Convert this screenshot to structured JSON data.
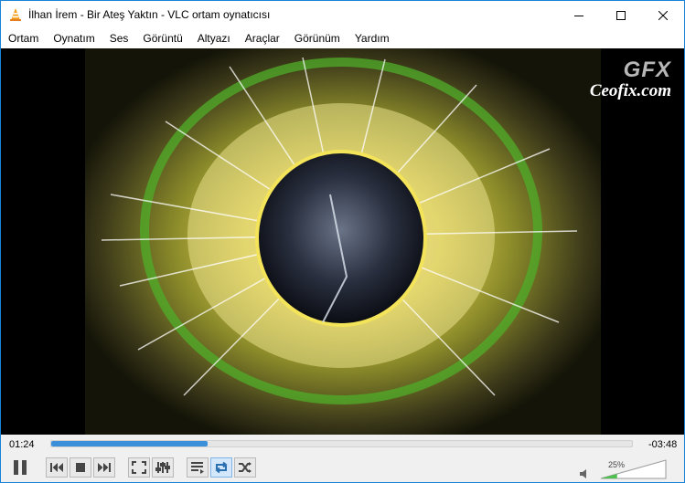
{
  "window": {
    "title": "İlhan İrem - Bir Ateş Yaktın - VLC ortam oynatıcısı",
    "accent_color": "#1883d7"
  },
  "menu": {
    "items": [
      "Ortam",
      "Oynatım",
      "Ses",
      "Görüntü",
      "Altyazı",
      "Araçlar",
      "Görünüm",
      "Yardım"
    ]
  },
  "watermark": {
    "mark": "GFX",
    "text": "Ceofix.com"
  },
  "player": {
    "elapsed": "01:24",
    "remaining": "-03:48",
    "progress": 0.27,
    "volume_label": "25%",
    "volume": 0.25,
    "loop_active": true,
    "progress_color": "#3c8fd9",
    "volume_color": "#4fbf4f"
  },
  "icons": {
    "app": "vlc-cone-icon",
    "pause": "pause-icon",
    "previous": "previous-icon",
    "stop": "stop-icon",
    "next": "next-icon",
    "fullscreen": "fullscreen-icon",
    "extended": "extended-settings-icon",
    "playlist": "playlist-icon",
    "loop": "loop-icon",
    "random": "shuffle-icon",
    "volume": "speaker-icon"
  }
}
